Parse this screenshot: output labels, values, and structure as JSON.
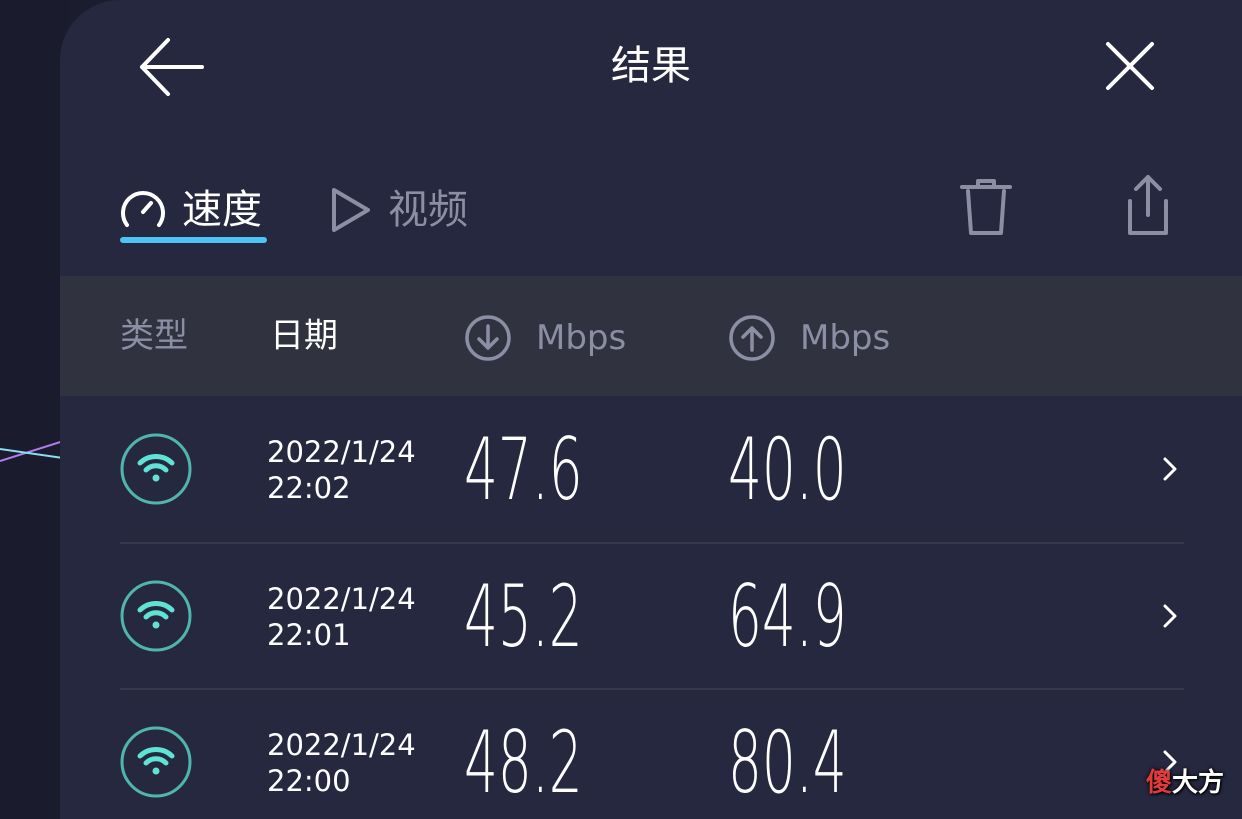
{
  "header": {
    "title": "结果"
  },
  "tabs": [
    {
      "label": "速度",
      "icon": "speedometer-icon",
      "active": true
    },
    {
      "label": "视频",
      "icon": "play-icon",
      "active": false
    }
  ],
  "toolbar": {
    "delete_icon": "trash-icon",
    "share_icon": "share-icon"
  },
  "columns": {
    "type": "类型",
    "date": "日期",
    "download_unit": "Mbps",
    "upload_unit": "Mbps"
  },
  "results": [
    {
      "date": "2022/1/24",
      "time": "22:02",
      "download": "47.6",
      "upload": "40.0",
      "connection": "wifi-icon"
    },
    {
      "date": "2022/1/24",
      "time": "22:01",
      "download": "45.2",
      "upload": "64.9",
      "connection": "wifi-icon"
    },
    {
      "date": "2022/1/24",
      "time": "22:00",
      "download": "48.2",
      "upload": "80.4",
      "connection": "wifi-icon"
    }
  ],
  "watermark": {
    "first": "傻",
    "rest": "大方"
  },
  "colors": {
    "background": "#262840",
    "accent": "#4ec3f5",
    "wifi": "#5fe3d4",
    "muted_text": "#8c8ea3"
  }
}
